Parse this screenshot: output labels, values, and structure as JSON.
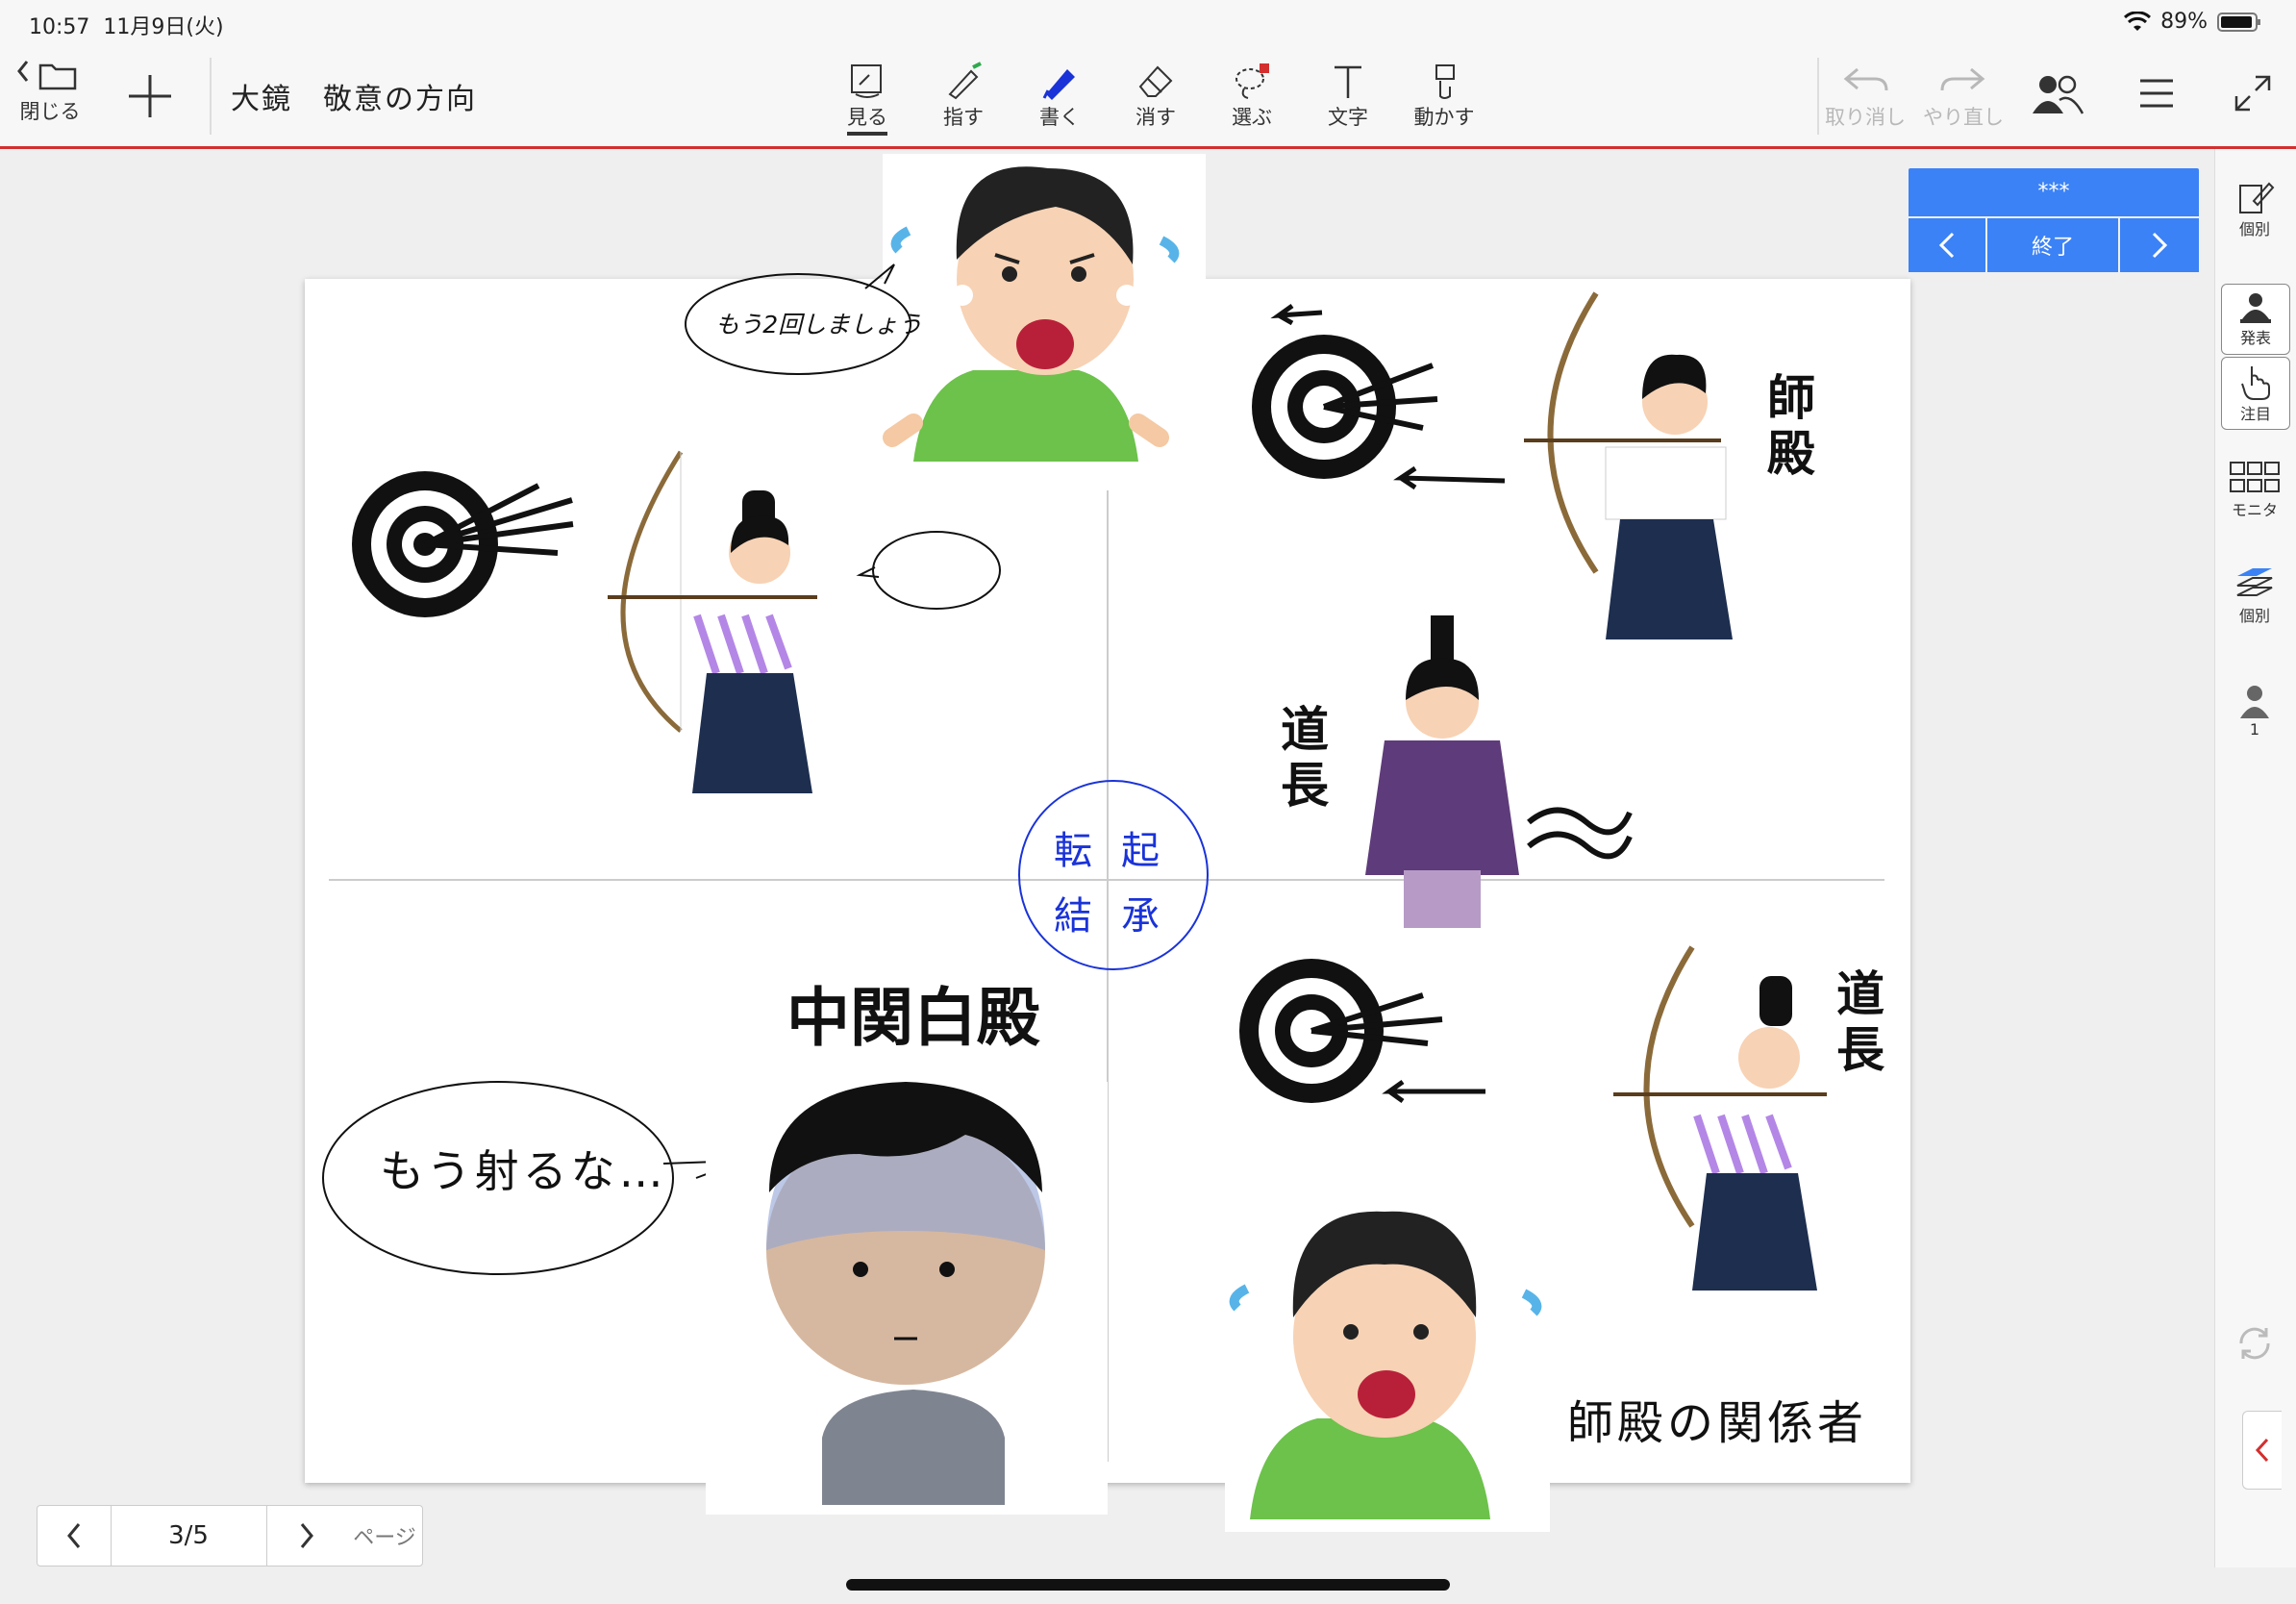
{
  "status_bar": {
    "time": "10:57",
    "date": "11月9日(火)",
    "battery": "89%"
  },
  "toolbar": {
    "close_label": "閉じる",
    "document_title": "大鏡　敬意の方向",
    "tools": [
      {
        "label": "見る",
        "icon": "view-icon"
      },
      {
        "label": "指す",
        "icon": "pointer-pen-icon"
      },
      {
        "label": "書く",
        "icon": "pen-icon"
      },
      {
        "label": "消す",
        "icon": "eraser-icon"
      },
      {
        "label": "選ぶ",
        "icon": "lasso-icon"
      },
      {
        "label": "文字",
        "icon": "text-icon"
      },
      {
        "label": "動かす",
        "icon": "move-icon"
      }
    ],
    "undo_label": "取り消し",
    "redo_label": "やり直し"
  },
  "presentation_panel": {
    "title": "***",
    "end_label": "終了"
  },
  "right_sidebar": {
    "items": [
      {
        "label": "個別",
        "icon": "individual-edit-icon"
      },
      {
        "label": "発表",
        "icon": "presenter-icon"
      },
      {
        "label": "注目",
        "icon": "attention-hand-icon"
      },
      {
        "label": "モニタ",
        "icon": "monitor-grid-icon"
      },
      {
        "label": "個別",
        "icon": "layers-icon"
      },
      {
        "label": "1",
        "icon": "person-icon"
      }
    ]
  },
  "sheet": {
    "speech_top": "もう2回しましょう",
    "speech_bottom": "もう射るな…",
    "label_shiden_1": "師殿",
    "label_michinaga_1": "道長",
    "label_michinaga_2": "道長",
    "label_chukanpaku": "中関白殿",
    "label_kankeisha": "師殿の関係者",
    "circle": {
      "ten": "転",
      "ki": "起",
      "ketsu": "結",
      "sho": "承"
    }
  },
  "pager": {
    "current": "3/5",
    "page_label": "ページ"
  },
  "colors": {
    "accent_red": "#d32f2f",
    "presentation_blue": "#3b82f6",
    "pen_blue": "#1a33d8"
  }
}
